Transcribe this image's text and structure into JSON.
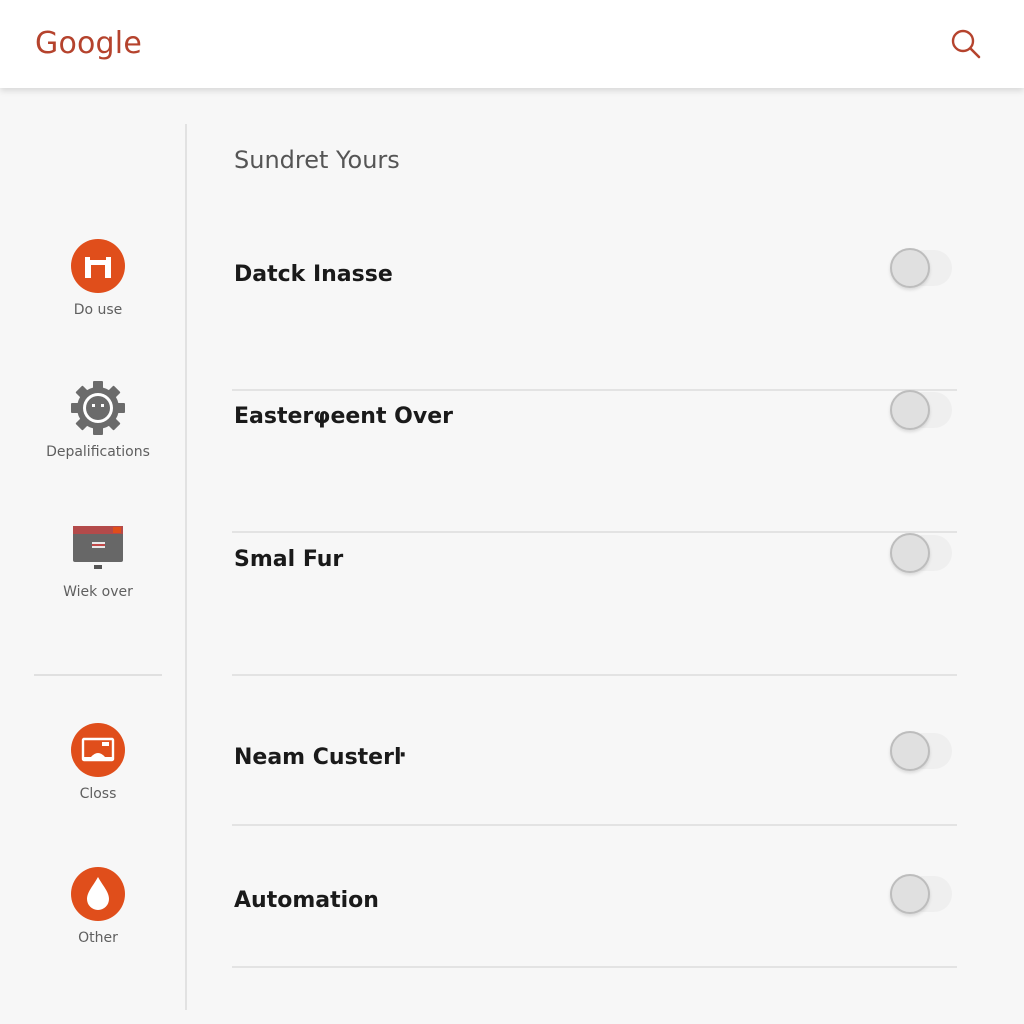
{
  "header": {
    "logo": "Google",
    "search_icon": "search-icon"
  },
  "colors": {
    "accent": "#e04e1b",
    "logo": "#b5432d",
    "gear": "#6b6b6b"
  },
  "sidebar": {
    "items": [
      {
        "label": "Do use",
        "icon": "app-icon"
      },
      {
        "label": "Depalifications",
        "icon": "gear-icon"
      },
      {
        "label": "Wiek over",
        "icon": "monitor-icon"
      },
      {
        "label": "Closs",
        "icon": "card-icon"
      },
      {
        "label": "Other",
        "icon": "drop-icon"
      }
    ]
  },
  "main": {
    "section_title": "Sundret Yours",
    "settings": [
      {
        "label": "Datck Inasse",
        "enabled": false
      },
      {
        "label": "Easterφeent Over",
        "enabled": false
      },
      {
        "label": "Smal Fur",
        "enabled": false
      },
      {
        "label": "Neam Custerŀ",
        "enabled": false
      },
      {
        "label": "Automation",
        "enabled": false
      }
    ]
  }
}
